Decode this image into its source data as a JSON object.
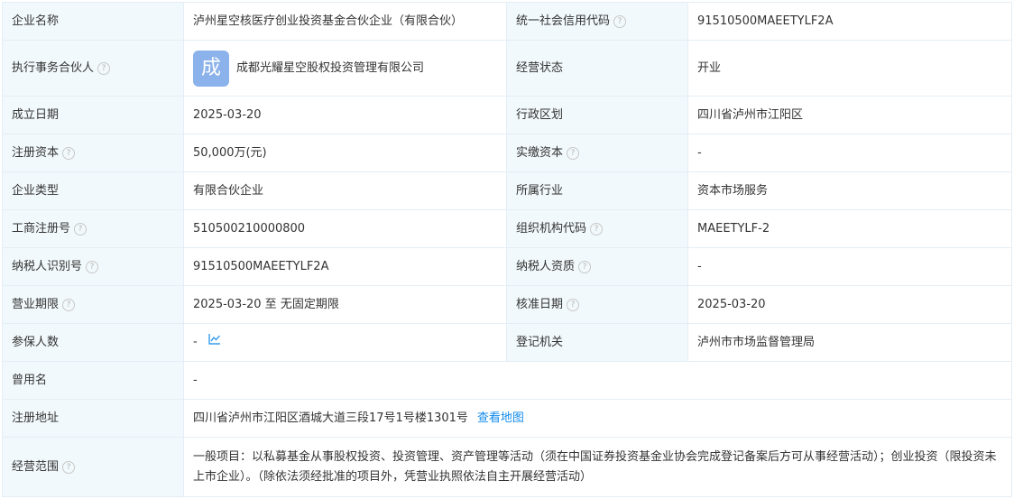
{
  "rows": {
    "company_name": {
      "label": "企业名称",
      "value": "泸州星空核医疗创业投资基金合伙企业（有限合伙）"
    },
    "credit_code": {
      "label": "统一社会信用代码",
      "value": "91510500MAEETYLF2A"
    },
    "partner": {
      "label": "执行事务合伙人",
      "logo_char": "成",
      "value": "成都光耀星空股权投资管理有限公司"
    },
    "status": {
      "label": "经营状态",
      "value": "开业"
    },
    "founded": {
      "label": "成立日期",
      "value": "2025-03-20"
    },
    "region": {
      "label": "行政区划",
      "value": "四川省泸州市江阳区"
    },
    "reg_capital": {
      "label": "注册资本",
      "value": "50,000万(元)"
    },
    "paid_capital": {
      "label": "实缴资本",
      "value": "-"
    },
    "type": {
      "label": "企业类型",
      "value": "有限合伙企业"
    },
    "industry": {
      "label": "所属行业",
      "value": "资本市场服务"
    },
    "reg_no": {
      "label": "工商注册号",
      "value": "510500210000800"
    },
    "org_code": {
      "label": "组织机构代码",
      "value": "MAEETYLF-2"
    },
    "taxpayer_id": {
      "label": "纳税人识别号",
      "value": "91510500MAEETYLF2A"
    },
    "taxpayer_qual": {
      "label": "纳税人资质",
      "value": "-"
    },
    "term": {
      "label": "营业期限",
      "value": "2025-03-20 至 无固定期限"
    },
    "approval_date": {
      "label": "核准日期",
      "value": "2025-03-20"
    },
    "insured": {
      "label": "参保人数",
      "value": "-"
    },
    "authority": {
      "label": "登记机关",
      "value": "泸州市市场监督管理局"
    },
    "former_name": {
      "label": "曾用名",
      "value": "-"
    },
    "address": {
      "label": "注册地址",
      "value": "四川省泸州市江阳区酒城大道三段17号1号楼1301号",
      "map_link": "查看地图"
    },
    "scope": {
      "label": "经营范围",
      "value": "一般项目：以私募基金从事股权投资、投资管理、资产管理等活动（须在中国证券投资基金业协会完成登记备案后方可从事经营活动）；创业投资（限投资未上市企业）。（除依法须经批准的项目外，凭营业执照依法自主开展经营活动）"
    }
  },
  "help_glyph": "?",
  "icons": {
    "help": "question-circle-icon",
    "trend": "trend-chart-icon"
  },
  "colors": {
    "key_bg": "#f2f9fc",
    "border": "#e4eef6",
    "link": "#128bed",
    "logo_bg": "#8bb2ea"
  }
}
